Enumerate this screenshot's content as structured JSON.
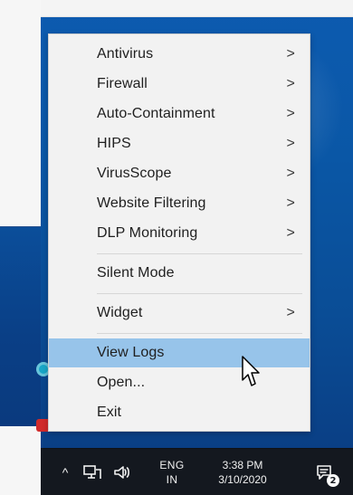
{
  "menu": {
    "items": [
      {
        "label": "Antivirus",
        "has_submenu": true
      },
      {
        "label": "Firewall",
        "has_submenu": true
      },
      {
        "label": "Auto-Containment",
        "has_submenu": true
      },
      {
        "label": "HIPS",
        "has_submenu": true
      },
      {
        "label": "VirusScope",
        "has_submenu": true
      },
      {
        "label": "Website Filtering",
        "has_submenu": true
      },
      {
        "label": "DLP Monitoring",
        "has_submenu": true
      },
      {
        "label": "Silent Mode",
        "has_submenu": false
      },
      {
        "label": "Widget",
        "has_submenu": true
      },
      {
        "label": "View Logs",
        "has_submenu": false,
        "highlighted": true
      },
      {
        "label": "Open...",
        "has_submenu": false
      },
      {
        "label": "Exit",
        "has_submenu": false
      }
    ],
    "submenu_chevron": ">"
  },
  "taskbar": {
    "caret": "^",
    "language": {
      "line1": "ENG",
      "line2": "IN"
    },
    "clock": {
      "time": "3:38 PM",
      "date": "3/10/2020"
    },
    "notifications_badge": "2"
  },
  "icons": {
    "network": "network-icon",
    "volume": "volume-icon",
    "notifications": "notifications-icon",
    "cursor": "mouse-pointer-icon"
  },
  "colors": {
    "menu_bg": "#f2f2f2",
    "menu_highlight": "#97c4ea",
    "taskbar_bg": "#14181f",
    "desktop_blue": "#0a57a6"
  }
}
